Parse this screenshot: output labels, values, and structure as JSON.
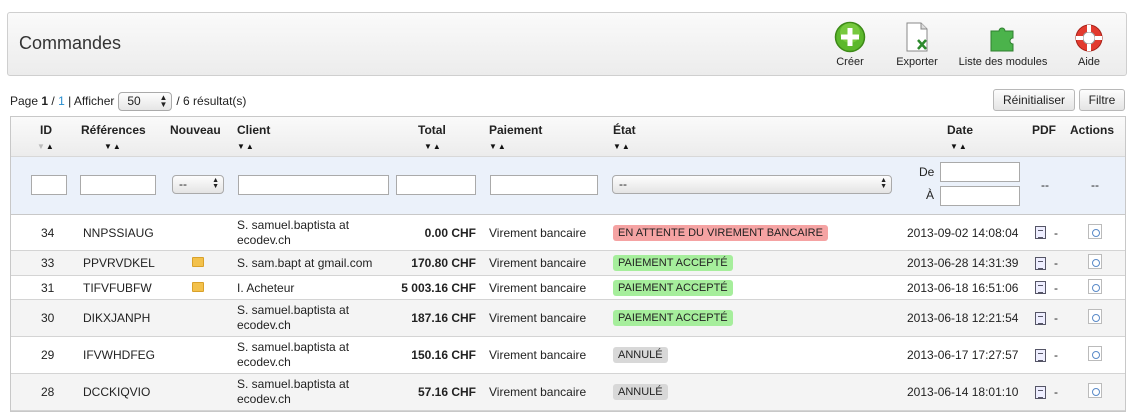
{
  "header": {
    "title": "Commandes",
    "actions": [
      {
        "label": "Créer",
        "icon": "plus-circle-icon"
      },
      {
        "label": "Exporter",
        "icon": "excel-export-icon"
      },
      {
        "label": "Liste des modules",
        "icon": "puzzle-icon"
      },
      {
        "label": "Aide",
        "icon": "lifebuoy-icon"
      }
    ]
  },
  "pager": {
    "page_prefix": "Page",
    "current_page": "1",
    "total_pages": "1",
    "show_label": "| Afficher",
    "per_page": "50",
    "results": "/ 6 résultat(s)"
  },
  "filter_buttons": {
    "reset": "Réinitialiser",
    "filter": "Filtre"
  },
  "columns": {
    "id": "ID",
    "ref": "Références",
    "new": "Nouveau",
    "client": "Client",
    "total": "Total",
    "payment": "Paiement",
    "state": "État",
    "date": "Date",
    "pdf": "PDF",
    "actions": "Actions"
  },
  "filters": {
    "new_value": "--",
    "state_value": "--",
    "date_from": "De",
    "date_to": "À",
    "pdf_value": "--",
    "actions_value": "--"
  },
  "colors": {
    "waiting": "#f5a3a3",
    "accepted": "#a6ee9c",
    "cancelled": "#d8d8d8"
  },
  "orders": [
    {
      "id": "34",
      "ref": "NNPSSIAUG",
      "new": false,
      "client_l1": "S. samuel.baptista at",
      "client_l2": "ecodev.ch",
      "total": "0.00 CHF",
      "payment": "Virement bancaire",
      "state": "EN ATTENTE DU VIREMENT BANCAIRE",
      "state_kind": "waiting",
      "date": "2013-09-02 14:08:04",
      "dash": "-"
    },
    {
      "id": "33",
      "ref": "PPVRVDKEL",
      "new": true,
      "client_l1": "S. sam.bapt at gmail.com",
      "client_l2": "",
      "total": "170.80 CHF",
      "payment": "Virement bancaire",
      "state": "PAIEMENT ACCEPTÉ",
      "state_kind": "accepted",
      "date": "2013-06-28 14:31:39",
      "dash": "-"
    },
    {
      "id": "31",
      "ref": "TIFVFUBFW",
      "new": true,
      "client_l1": "I. Acheteur",
      "client_l2": "",
      "total": "5 003.16 CHF",
      "payment": "Virement bancaire",
      "state": "PAIEMENT ACCEPTÉ",
      "state_kind": "accepted",
      "date": "2013-06-18 16:51:06",
      "dash": "-"
    },
    {
      "id": "30",
      "ref": "DIKXJANPH",
      "new": false,
      "client_l1": "S. samuel.baptista at",
      "client_l2": "ecodev.ch",
      "total": "187.16 CHF",
      "payment": "Virement bancaire",
      "state": "PAIEMENT ACCEPTÉ",
      "state_kind": "accepted",
      "date": "2013-06-18 12:21:54",
      "dash": "-"
    },
    {
      "id": "29",
      "ref": "IFVWHDFEG",
      "new": false,
      "client_l1": "S. samuel.baptista at",
      "client_l2": "ecodev.ch",
      "total": "150.16 CHF",
      "payment": "Virement bancaire",
      "state": "ANNULÉ",
      "state_kind": "cancelled",
      "date": "2013-06-17 17:27:57",
      "dash": "-"
    },
    {
      "id": "28",
      "ref": "DCCKIQVIO",
      "new": false,
      "client_l1": "S. samuel.baptista at",
      "client_l2": "ecodev.ch",
      "total": "57.16 CHF",
      "payment": "Virement bancaire",
      "state": "ANNULÉ",
      "state_kind": "cancelled",
      "date": "2013-06-14 18:01:10",
      "dash": "-"
    }
  ]
}
